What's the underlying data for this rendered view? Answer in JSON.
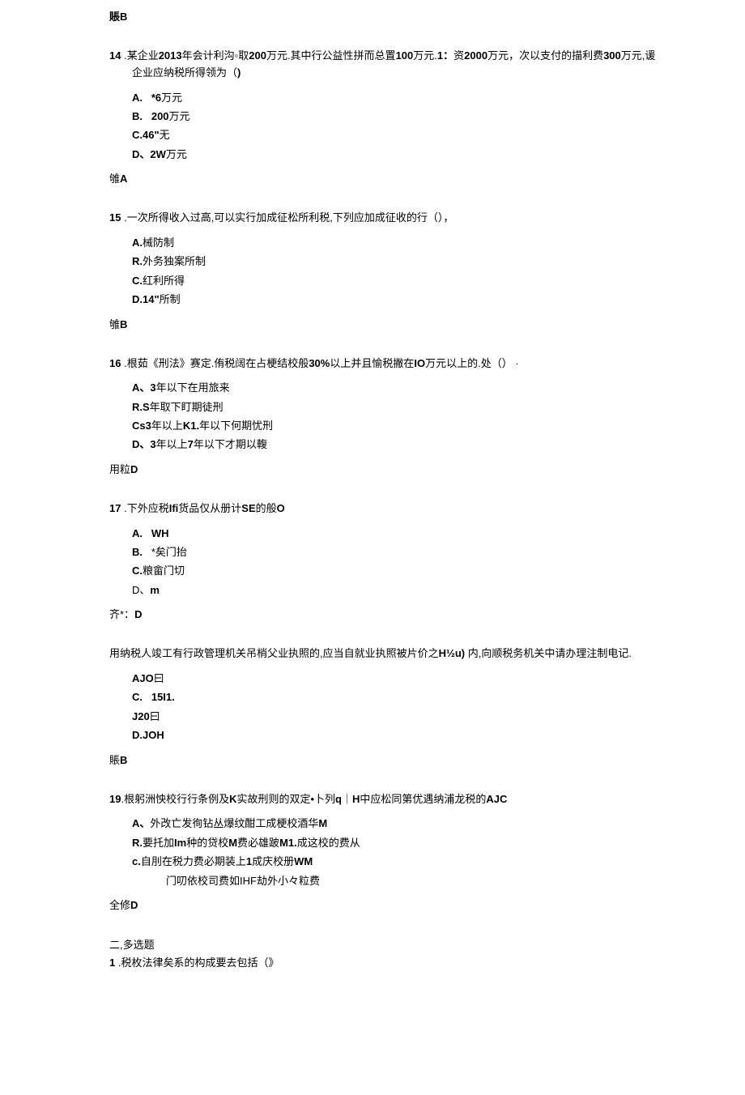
{
  "q13": {
    "answer": "賬B"
  },
  "q14": {
    "num": "14",
    "stem_a": " .某企业",
    "stem_b": "2013",
    "stem_c": "年会计利沟◦取",
    "stem_d": "200",
    "stem_e": "万元.其中行公益性拼而总置",
    "stem_f": "100",
    "stem_g": "万元.",
    "stem_h": "1：",
    "stem_i": "资",
    "stem_j": "2000",
    "stem_k": "万元，次以支付的描利费",
    "stem_l": "300",
    "stem_m": "万元,谖企业应纳税所得领为（",
    "stem_n": ")",
    "optA": {
      "label": "A.",
      "text": "*6",
      "suffix": "万元"
    },
    "optB": {
      "label": "B.",
      "text": "200",
      "suffix": "万元"
    },
    "optC": {
      "label": "C.46\"",
      "text": "无"
    },
    "optD": {
      "label": "D、2W",
      "text": "万元"
    },
    "answer_prefix": "雊",
    "answer": "A"
  },
  "q15": {
    "num": "15",
    "stem": " .一次所得收入过高,可以实行加成征松所利税,下列应加成征收的行（），",
    "optA": {
      "label": "A.",
      "text": "械防制"
    },
    "optB": {
      "label": "R.",
      "text": "外务独案所制"
    },
    "optC": {
      "label": "C.",
      "text": "红利所得"
    },
    "optD": {
      "label": "D.14\"",
      "text": "所制"
    },
    "answer_prefix": "雊",
    "answer": "B"
  },
  "q16": {
    "num": "16",
    "stem_a": " .根茹《刑法》赛定.侑税阔在占梗结校般",
    "stem_b": "30%",
    "stem_c": "以上并且愉税撇在",
    "stem_d": "IO",
    "stem_e": "万元以上的.处（） ·",
    "optA": {
      "label": "A、3",
      "text": "年以下在用旅来"
    },
    "optB": {
      "label": "R.S",
      "text": "年取下盯期徒刑"
    },
    "optC": {
      "label": "Cs3",
      "text_a": "年以上",
      "text_b": "K1.",
      "text_c": "年以下何期忧刑"
    },
    "optD": {
      "label": "D、3",
      "text_a": "年以上",
      "text_b": "7",
      "text_c": "年以下才期以輹"
    },
    "answer_prefix": "用粒",
    "answer": "D"
  },
  "q17": {
    "num": "17",
    "stem_a": " .下外应税",
    "stem_b": "Ifi",
    "stem_c": "货品仅从册计",
    "stem_d": "SE",
    "stem_e": "的般",
    "stem_f": "O",
    "optA": {
      "label": "A.",
      "text": "WH"
    },
    "optB": {
      "label": "B.",
      "text_a": "*",
      "text_b": "矣门抬"
    },
    "optC": {
      "label": "C.",
      "text": "粮畲门切"
    },
    "optD": {
      "label": "D、",
      "text": "m"
    },
    "answer_prefix": "齐*：",
    "answer": "D"
  },
  "q18": {
    "stem_a": "用纳税人竣工有行政管理机关吊梢父业执照的,应当自就业执照被片价之",
    "stem_b": "H½u)",
    "stem_c": " 内,向顺税务机关中请办理注制电记.",
    "optA": {
      "label": "AJO",
      "text": "曰"
    },
    "optB": {
      "label": "C.",
      "text": "15I1."
    },
    "optC": {
      "label": "J20",
      "text": "曰"
    },
    "optD": {
      "label": "D.JOH",
      "text": ""
    },
    "answer_prefix": "賬",
    "answer": "B"
  },
  "q19": {
    "num": "19",
    "stem_a": ".根躬洲怏校行行条例及",
    "stem_b": "K",
    "stem_c": "实故刑则的双定•卜列",
    "stem_d": "q",
    "stem_e": "｜",
    "stem_f": "H",
    "stem_g": "中应松同第优遇纳浦龙税的",
    "stem_h": "AJC",
    "optA": {
      "label": "A、",
      "text_a": "外改亡发徇钻丛爆纹酣工成梗校酒华",
      "text_b": "M"
    },
    "optB": {
      "label": "R.",
      "text_a": "要托加",
      "text_b": "Im",
      "text_c": "种的贷校",
      "text_d": "M",
      "text_e": "费必雄跛",
      "text_f": "M1.",
      "text_g": "成这校的费从"
    },
    "optC": {
      "label": "c.",
      "text_a": "自刖在税力费必期装上",
      "text_b": "1",
      "text_c": "成庆校册",
      "text_d": "WM"
    },
    "optD": {
      "text_a": "门叨依校司费如",
      "text_b": "IHF",
      "text_c": "劫外小々粒费"
    },
    "answer_prefix": "全修",
    "answer": "D"
  },
  "section2": {
    "heading": "二,多选题",
    "q1": {
      "num": "1",
      "stem": " .税枚法律矣系的构成要去包括（》"
    }
  }
}
